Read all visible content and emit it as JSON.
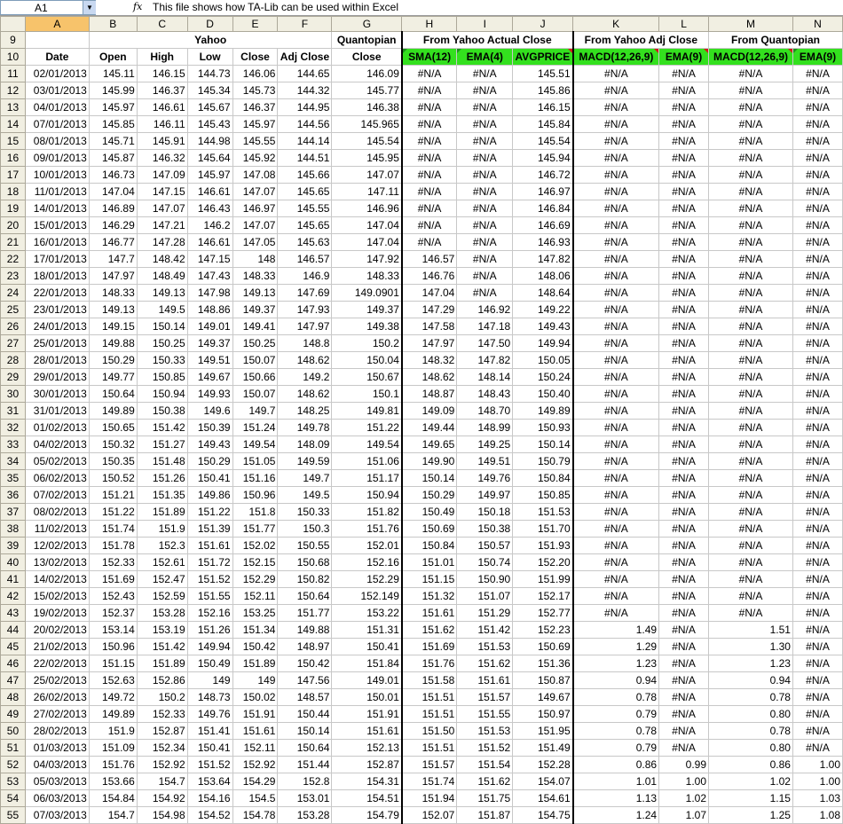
{
  "formula_bar": {
    "name_box": "A1",
    "fx_symbol": "fx",
    "formula": "This file shows how TA-Lib can be used within Excel"
  },
  "columns": [
    "A",
    "B",
    "C",
    "D",
    "E",
    "F",
    "G",
    "H",
    "I",
    "J",
    "K",
    "L",
    "M",
    "N"
  ],
  "header_rows": {
    "row9": {
      "num": "9",
      "yahoo": "Yahoo",
      "quantopian": "Quantopian",
      "from_actual": "From Yahoo Actual Close",
      "from_adj": "From Yahoo Adj Close",
      "from_quantopian": "From Quantopian"
    },
    "row10": {
      "num": "10",
      "cells": [
        "Date",
        "Open",
        "High",
        "Low",
        "Close",
        "Adj Close",
        "Close",
        "SMA(12)",
        "EMA(4)",
        "AVGPRICE",
        "MACD(12,26,9)",
        "EMA(9)",
        "MACD(12,26,9)",
        "EMA(9)"
      ]
    }
  },
  "rows": [
    {
      "n": "11",
      "c": [
        "02/01/2013",
        "145.11",
        "146.15",
        "144.73",
        "146.06",
        "144.65",
        "146.09",
        "#N/A",
        "#N/A",
        "145.51",
        "#N/A",
        "#N/A",
        "#N/A",
        "#N/A"
      ]
    },
    {
      "n": "12",
      "c": [
        "03/01/2013",
        "145.99",
        "146.37",
        "145.34",
        "145.73",
        "144.32",
        "145.77",
        "#N/A",
        "#N/A",
        "145.86",
        "#N/A",
        "#N/A",
        "#N/A",
        "#N/A"
      ]
    },
    {
      "n": "13",
      "c": [
        "04/01/2013",
        "145.97",
        "146.61",
        "145.67",
        "146.37",
        "144.95",
        "146.38",
        "#N/A",
        "#N/A",
        "146.15",
        "#N/A",
        "#N/A",
        "#N/A",
        "#N/A"
      ]
    },
    {
      "n": "14",
      "c": [
        "07/01/2013",
        "145.85",
        "146.11",
        "145.43",
        "145.97",
        "144.56",
        "145.965",
        "#N/A",
        "#N/A",
        "145.84",
        "#N/A",
        "#N/A",
        "#N/A",
        "#N/A"
      ]
    },
    {
      "n": "15",
      "c": [
        "08/01/2013",
        "145.71",
        "145.91",
        "144.98",
        "145.55",
        "144.14",
        "145.54",
        "#N/A",
        "#N/A",
        "145.54",
        "#N/A",
        "#N/A",
        "#N/A",
        "#N/A"
      ]
    },
    {
      "n": "16",
      "c": [
        "09/01/2013",
        "145.87",
        "146.32",
        "145.64",
        "145.92",
        "144.51",
        "145.95",
        "#N/A",
        "#N/A",
        "145.94",
        "#N/A",
        "#N/A",
        "#N/A",
        "#N/A"
      ]
    },
    {
      "n": "17",
      "c": [
        "10/01/2013",
        "146.73",
        "147.09",
        "145.97",
        "147.08",
        "145.66",
        "147.07",
        "#N/A",
        "#N/A",
        "146.72",
        "#N/A",
        "#N/A",
        "#N/A",
        "#N/A"
      ]
    },
    {
      "n": "18",
      "c": [
        "11/01/2013",
        "147.04",
        "147.15",
        "146.61",
        "147.07",
        "145.65",
        "147.11",
        "#N/A",
        "#N/A",
        "146.97",
        "#N/A",
        "#N/A",
        "#N/A",
        "#N/A"
      ]
    },
    {
      "n": "19",
      "c": [
        "14/01/2013",
        "146.89",
        "147.07",
        "146.43",
        "146.97",
        "145.55",
        "146.96",
        "#N/A",
        "#N/A",
        "146.84",
        "#N/A",
        "#N/A",
        "#N/A",
        "#N/A"
      ]
    },
    {
      "n": "20",
      "c": [
        "15/01/2013",
        "146.29",
        "147.21",
        "146.2",
        "147.07",
        "145.65",
        "147.04",
        "#N/A",
        "#N/A",
        "146.69",
        "#N/A",
        "#N/A",
        "#N/A",
        "#N/A"
      ]
    },
    {
      "n": "21",
      "c": [
        "16/01/2013",
        "146.77",
        "147.28",
        "146.61",
        "147.05",
        "145.63",
        "147.04",
        "#N/A",
        "#N/A",
        "146.93",
        "#N/A",
        "#N/A",
        "#N/A",
        "#N/A"
      ]
    },
    {
      "n": "22",
      "c": [
        "17/01/2013",
        "147.7",
        "148.42",
        "147.15",
        "148",
        "146.57",
        "147.92",
        "146.57",
        "#N/A",
        "147.82",
        "#N/A",
        "#N/A",
        "#N/A",
        "#N/A"
      ]
    },
    {
      "n": "23",
      "c": [
        "18/01/2013",
        "147.97",
        "148.49",
        "147.43",
        "148.33",
        "146.9",
        "148.33",
        "146.76",
        "#N/A",
        "148.06",
        "#N/A",
        "#N/A",
        "#N/A",
        "#N/A"
      ]
    },
    {
      "n": "24",
      "c": [
        "22/01/2013",
        "148.33",
        "149.13",
        "147.98",
        "149.13",
        "147.69",
        "149.0901",
        "147.04",
        "#N/A",
        "148.64",
        "#N/A",
        "#N/A",
        "#N/A",
        "#N/A"
      ]
    },
    {
      "n": "25",
      "c": [
        "23/01/2013",
        "149.13",
        "149.5",
        "148.86",
        "149.37",
        "147.93",
        "149.37",
        "147.29",
        "146.92",
        "149.22",
        "#N/A",
        "#N/A",
        "#N/A",
        "#N/A"
      ]
    },
    {
      "n": "26",
      "c": [
        "24/01/2013",
        "149.15",
        "150.14",
        "149.01",
        "149.41",
        "147.97",
        "149.38",
        "147.58",
        "147.18",
        "149.43",
        "#N/A",
        "#N/A",
        "#N/A",
        "#N/A"
      ]
    },
    {
      "n": "27",
      "c": [
        "25/01/2013",
        "149.88",
        "150.25",
        "149.37",
        "150.25",
        "148.8",
        "150.2",
        "147.97",
        "147.50",
        "149.94",
        "#N/A",
        "#N/A",
        "#N/A",
        "#N/A"
      ]
    },
    {
      "n": "28",
      "c": [
        "28/01/2013",
        "150.29",
        "150.33",
        "149.51",
        "150.07",
        "148.62",
        "150.04",
        "148.32",
        "147.82",
        "150.05",
        "#N/A",
        "#N/A",
        "#N/A",
        "#N/A"
      ]
    },
    {
      "n": "29",
      "c": [
        "29/01/2013",
        "149.77",
        "150.85",
        "149.67",
        "150.66",
        "149.2",
        "150.67",
        "148.62",
        "148.14",
        "150.24",
        "#N/A",
        "#N/A",
        "#N/A",
        "#N/A"
      ]
    },
    {
      "n": "30",
      "c": [
        "30/01/2013",
        "150.64",
        "150.94",
        "149.93",
        "150.07",
        "148.62",
        "150.1",
        "148.87",
        "148.43",
        "150.40",
        "#N/A",
        "#N/A",
        "#N/A",
        "#N/A"
      ]
    },
    {
      "n": "31",
      "c": [
        "31/01/2013",
        "149.89",
        "150.38",
        "149.6",
        "149.7",
        "148.25",
        "149.81",
        "149.09",
        "148.70",
        "149.89",
        "#N/A",
        "#N/A",
        "#N/A",
        "#N/A"
      ]
    },
    {
      "n": "32",
      "c": [
        "01/02/2013",
        "150.65",
        "151.42",
        "150.39",
        "151.24",
        "149.78",
        "151.22",
        "149.44",
        "148.99",
        "150.93",
        "#N/A",
        "#N/A",
        "#N/A",
        "#N/A"
      ]
    },
    {
      "n": "33",
      "c": [
        "04/02/2013",
        "150.32",
        "151.27",
        "149.43",
        "149.54",
        "148.09",
        "149.54",
        "149.65",
        "149.25",
        "150.14",
        "#N/A",
        "#N/A",
        "#N/A",
        "#N/A"
      ]
    },
    {
      "n": "34",
      "c": [
        "05/02/2013",
        "150.35",
        "151.48",
        "150.29",
        "151.05",
        "149.59",
        "151.06",
        "149.90",
        "149.51",
        "150.79",
        "#N/A",
        "#N/A",
        "#N/A",
        "#N/A"
      ]
    },
    {
      "n": "35",
      "c": [
        "06/02/2013",
        "150.52",
        "151.26",
        "150.41",
        "151.16",
        "149.7",
        "151.17",
        "150.14",
        "149.76",
        "150.84",
        "#N/A",
        "#N/A",
        "#N/A",
        "#N/A"
      ]
    },
    {
      "n": "36",
      "c": [
        "07/02/2013",
        "151.21",
        "151.35",
        "149.86",
        "150.96",
        "149.5",
        "150.94",
        "150.29",
        "149.97",
        "150.85",
        "#N/A",
        "#N/A",
        "#N/A",
        "#N/A"
      ]
    },
    {
      "n": "37",
      "c": [
        "08/02/2013",
        "151.22",
        "151.89",
        "151.22",
        "151.8",
        "150.33",
        "151.82",
        "150.49",
        "150.18",
        "151.53",
        "#N/A",
        "#N/A",
        "#N/A",
        "#N/A"
      ]
    },
    {
      "n": "38",
      "c": [
        "11/02/2013",
        "151.74",
        "151.9",
        "151.39",
        "151.77",
        "150.3",
        "151.76",
        "150.69",
        "150.38",
        "151.70",
        "#N/A",
        "#N/A",
        "#N/A",
        "#N/A"
      ]
    },
    {
      "n": "39",
      "c": [
        "12/02/2013",
        "151.78",
        "152.3",
        "151.61",
        "152.02",
        "150.55",
        "152.01",
        "150.84",
        "150.57",
        "151.93",
        "#N/A",
        "#N/A",
        "#N/A",
        "#N/A"
      ]
    },
    {
      "n": "40",
      "c": [
        "13/02/2013",
        "152.33",
        "152.61",
        "151.72",
        "152.15",
        "150.68",
        "152.16",
        "151.01",
        "150.74",
        "152.20",
        "#N/A",
        "#N/A",
        "#N/A",
        "#N/A"
      ]
    },
    {
      "n": "41",
      "c": [
        "14/02/2013",
        "151.69",
        "152.47",
        "151.52",
        "152.29",
        "150.82",
        "152.29",
        "151.15",
        "150.90",
        "151.99",
        "#N/A",
        "#N/A",
        "#N/A",
        "#N/A"
      ]
    },
    {
      "n": "42",
      "c": [
        "15/02/2013",
        "152.43",
        "152.59",
        "151.55",
        "152.11",
        "150.64",
        "152.149",
        "151.32",
        "151.07",
        "152.17",
        "#N/A",
        "#N/A",
        "#N/A",
        "#N/A"
      ]
    },
    {
      "n": "43",
      "c": [
        "19/02/2013",
        "152.37",
        "153.28",
        "152.16",
        "153.25",
        "151.77",
        "153.22",
        "151.61",
        "151.29",
        "152.77",
        "#N/A",
        "#N/A",
        "#N/A",
        "#N/A"
      ]
    },
    {
      "n": "44",
      "c": [
        "20/02/2013",
        "153.14",
        "153.19",
        "151.26",
        "151.34",
        "149.88",
        "151.31",
        "151.62",
        "151.42",
        "152.23",
        "1.49",
        "#N/A",
        "1.51",
        "#N/A"
      ]
    },
    {
      "n": "45",
      "c": [
        "21/02/2013",
        "150.96",
        "151.42",
        "149.94",
        "150.42",
        "148.97",
        "150.41",
        "151.69",
        "151.53",
        "150.69",
        "1.29",
        "#N/A",
        "1.30",
        "#N/A"
      ]
    },
    {
      "n": "46",
      "c": [
        "22/02/2013",
        "151.15",
        "151.89",
        "150.49",
        "151.89",
        "150.42",
        "151.84",
        "151.76",
        "151.62",
        "151.36",
        "1.23",
        "#N/A",
        "1.23",
        "#N/A"
      ]
    },
    {
      "n": "47",
      "c": [
        "25/02/2013",
        "152.63",
        "152.86",
        "149",
        "149",
        "147.56",
        "149.01",
        "151.58",
        "151.61",
        "150.87",
        "0.94",
        "#N/A",
        "0.94",
        "#N/A"
      ]
    },
    {
      "n": "48",
      "c": [
        "26/02/2013",
        "149.72",
        "150.2",
        "148.73",
        "150.02",
        "148.57",
        "150.01",
        "151.51",
        "151.57",
        "149.67",
        "0.78",
        "#N/A",
        "0.78",
        "#N/A"
      ]
    },
    {
      "n": "49",
      "c": [
        "27/02/2013",
        "149.89",
        "152.33",
        "149.76",
        "151.91",
        "150.44",
        "151.91",
        "151.51",
        "151.55",
        "150.97",
        "0.79",
        "#N/A",
        "0.80",
        "#N/A"
      ]
    },
    {
      "n": "50",
      "c": [
        "28/02/2013",
        "151.9",
        "152.87",
        "151.41",
        "151.61",
        "150.14",
        "151.61",
        "151.50",
        "151.53",
        "151.95",
        "0.78",
        "#N/A",
        "0.78",
        "#N/A"
      ]
    },
    {
      "n": "51",
      "c": [
        "01/03/2013",
        "151.09",
        "152.34",
        "150.41",
        "152.11",
        "150.64",
        "152.13",
        "151.51",
        "151.52",
        "151.49",
        "0.79",
        "#N/A",
        "0.80",
        "#N/A"
      ]
    },
    {
      "n": "52",
      "c": [
        "04/03/2013",
        "151.76",
        "152.92",
        "151.52",
        "152.92",
        "151.44",
        "152.87",
        "151.57",
        "151.54",
        "152.28",
        "0.86",
        "0.99",
        "0.86",
        "1.00"
      ]
    },
    {
      "n": "53",
      "c": [
        "05/03/2013",
        "153.66",
        "154.7",
        "153.64",
        "154.29",
        "152.8",
        "154.31",
        "151.74",
        "151.62",
        "154.07",
        "1.01",
        "1.00",
        "1.02",
        "1.00"
      ]
    },
    {
      "n": "54",
      "c": [
        "06/03/2013",
        "154.84",
        "154.92",
        "154.16",
        "154.5",
        "153.01",
        "154.51",
        "151.94",
        "151.75",
        "154.61",
        "1.13",
        "1.02",
        "1.15",
        "1.03"
      ]
    },
    {
      "n": "55",
      "c": [
        "07/03/2013",
        "154.7",
        "154.98",
        "154.52",
        "154.78",
        "153.28",
        "154.79",
        "152.07",
        "151.87",
        "154.75",
        "1.24",
        "1.07",
        "1.25",
        "1.08"
      ]
    }
  ],
  "colors": {
    "header_bg": "#f1efe2",
    "active_col": "#f7c36b",
    "green_header": "#33e01e",
    "grid": "#c8c8c8"
  }
}
